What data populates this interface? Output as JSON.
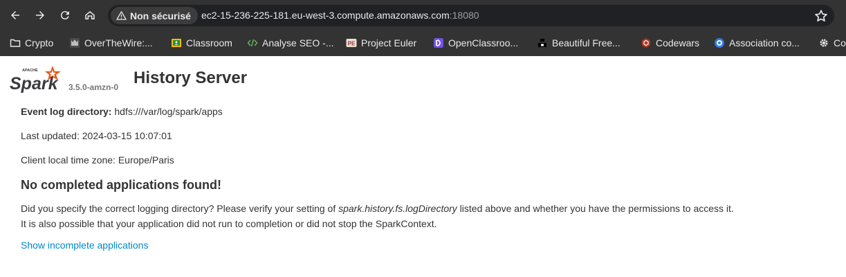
{
  "browser": {
    "security_label": "Non sécurisé",
    "url_host": "ec2-15-236-225-181.eu-west-3.compute.amazonaws.com",
    "url_port": ":18080",
    "bookmarks": [
      {
        "label": "Crypto",
        "icon": "folder-icon"
      },
      {
        "label": "OverTheWire:...",
        "icon": "overthewire-favicon"
      },
      {
        "label": "Classroom",
        "icon": "classroom-favicon"
      },
      {
        "label": "Analyse SEO -...",
        "icon": "code-favicon"
      },
      {
        "label": "Project Euler",
        "icon": "project-euler-favicon"
      },
      {
        "label": "OpenClassroo...",
        "icon": "openclassrooms-favicon"
      },
      {
        "label": "Beautiful Free...",
        "icon": "unsplash-favicon"
      },
      {
        "label": "Codewars",
        "icon": "codewars-favicon"
      },
      {
        "label": "Association co...",
        "icon": "association-favicon"
      },
      {
        "label": "Co",
        "icon": "gear-favicon"
      }
    ]
  },
  "spark": {
    "logo_small": "APACHE",
    "logo_word": "Spark",
    "version": "3.5.0-amzn-0",
    "title": "History Server",
    "event_log_label": "Event log directory:",
    "event_log_value": " hdfs:///var/log/spark/apps",
    "last_updated_label": "Last updated: ",
    "last_updated_value": "2024-03-15 10:07:01",
    "timezone_label": "Client local time zone: ",
    "timezone_value": "Europe/Paris",
    "no_apps_heading": "No completed applications found!",
    "msg_part1": "Did you specify the correct logging directory? Please verify your setting of ",
    "msg_setting": "spark.history.fs.logDirectory",
    "msg_part2": " listed above and whether you have the permissions to access it.",
    "msg_line2": "It is also possible that your application did not run to completion or did not stop the SparkContext.",
    "show_incomplete_link": "Show incomplete applications"
  },
  "colors": {
    "chrome_bg": "#333333",
    "omnibox_bg": "#202124",
    "link": "#0088cc",
    "spark_orange": "#e25a1c",
    "spark_dark": "#3c3a3e"
  }
}
